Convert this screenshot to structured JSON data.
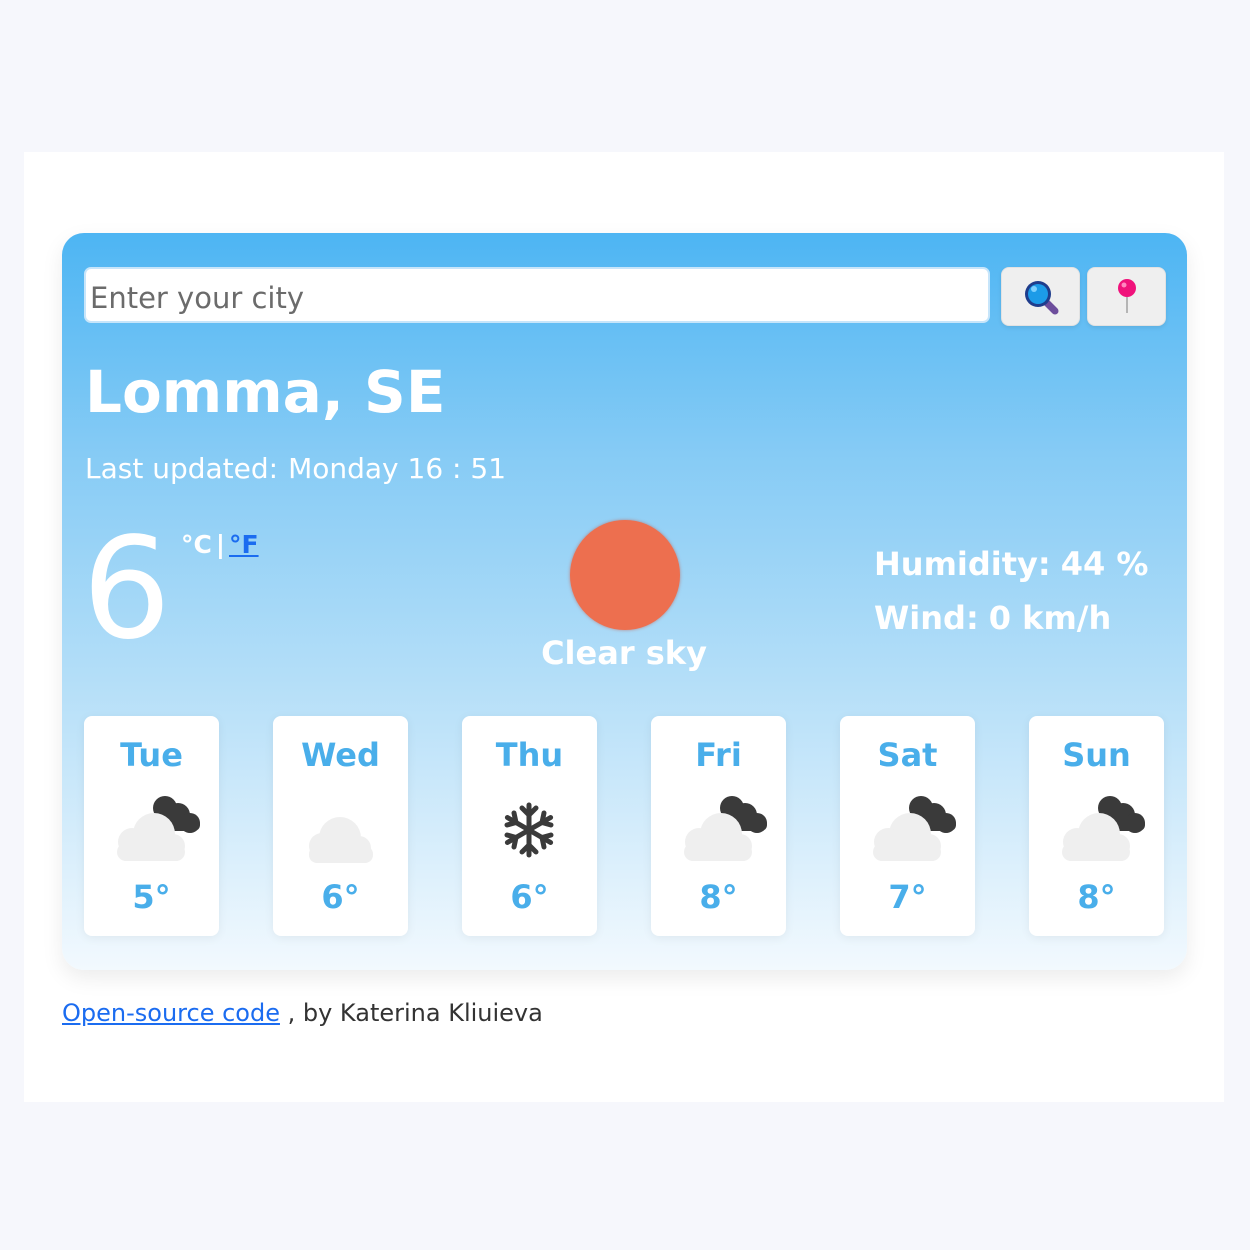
{
  "search": {
    "placeholder": "Enter your city",
    "search_icon": "magnifying-glass-icon",
    "location_icon": "round-pushpin-icon"
  },
  "current": {
    "city": "Lomma, SE",
    "last_updated_label": "Last updated:",
    "last_updated_value": "Monday 16 : 51",
    "temperature": "6",
    "unit_celsius": "°C",
    "unit_separator": "|",
    "unit_fahrenheit": "°F",
    "condition": "Clear sky",
    "condition_icon": "sun-icon",
    "humidity_label": "Humidity:",
    "humidity_value": "44 %",
    "wind_label": "Wind:",
    "wind_value": "0 km/h"
  },
  "forecast": [
    {
      "day": "Tue",
      "icon": "night-cloudy-icon",
      "temp": "5°"
    },
    {
      "day": "Wed",
      "icon": "cloud-icon",
      "temp": "6°"
    },
    {
      "day": "Thu",
      "icon": "snowflake-icon",
      "temp": "6°"
    },
    {
      "day": "Fri",
      "icon": "night-cloudy-icon",
      "temp": "8°"
    },
    {
      "day": "Sat",
      "icon": "night-cloudy-icon",
      "temp": "7°"
    },
    {
      "day": "Sun",
      "icon": "night-cloudy-icon",
      "temp": "8°"
    }
  ],
  "footer": {
    "link_text": "Open-source code",
    "suffix": ", by Katerina Kliuieva"
  },
  "colors": {
    "accent": "#49aeea",
    "sun": "#ed6f4f",
    "link": "#1b6cf0"
  }
}
